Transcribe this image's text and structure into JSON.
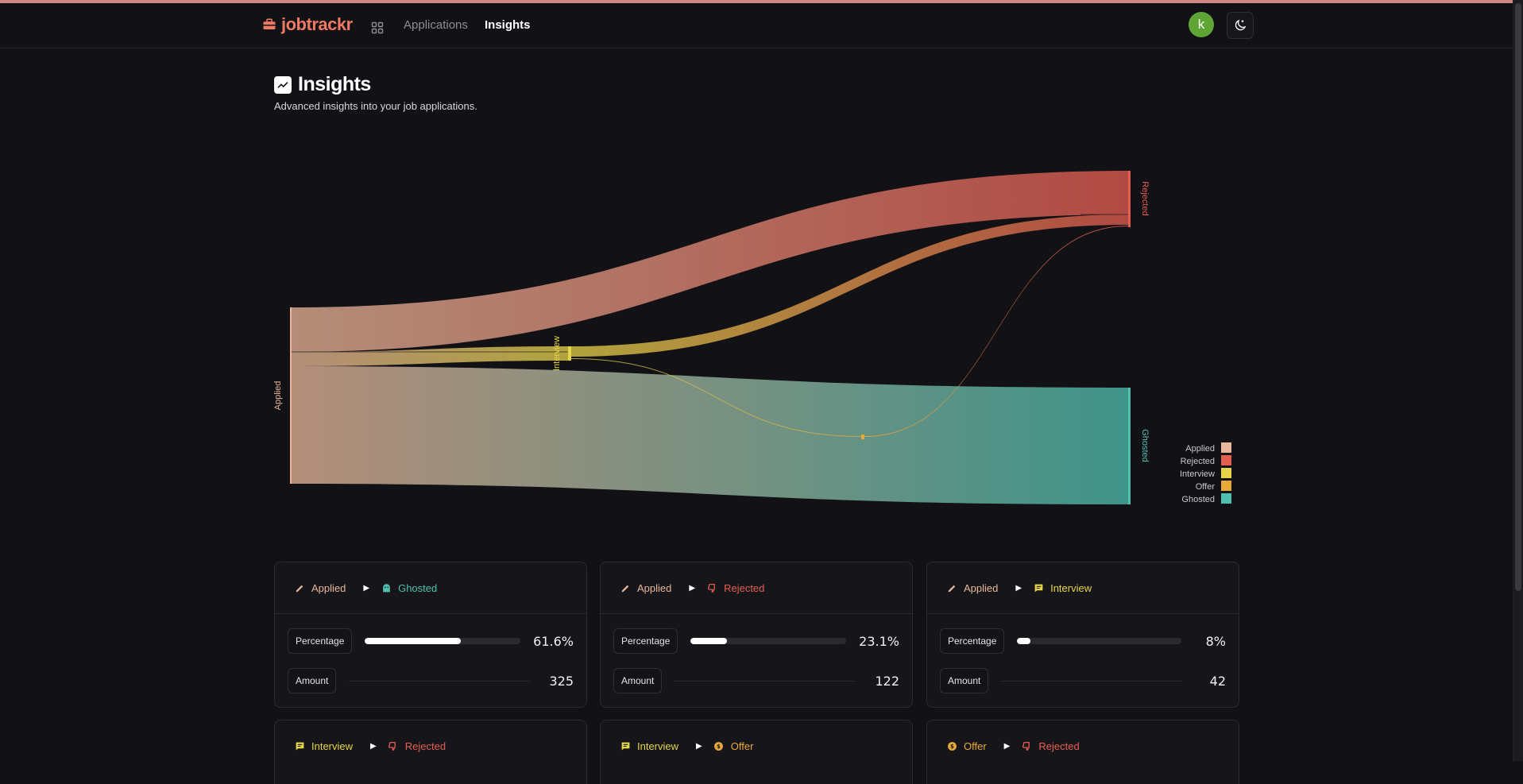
{
  "app": {
    "brand": "jobtrackr",
    "nav": {
      "applications": "Applications",
      "insights": "Insights"
    },
    "avatar_initial": "k"
  },
  "page": {
    "title": "Insights",
    "subtitle": "Advanced insights into your job applications."
  },
  "colors": {
    "applied": "#e9b79a",
    "rejected": "#e65d52",
    "interview": "#e6d449",
    "offer": "#e8a93b",
    "ghosted": "#4fc0b0",
    "brand": "#ee7a64",
    "avatar": "#5fa535"
  },
  "sankey": {
    "nodes": {
      "applied": "Applied",
      "interview": "Interview",
      "offer": "Offer",
      "rejected": "Rejected",
      "ghosted": "Ghosted"
    },
    "legend": [
      "Applied",
      "Rejected",
      "Interview",
      "Offer",
      "Ghosted"
    ]
  },
  "labels": {
    "percentage": "Percentage",
    "amount": "Amount"
  },
  "cards": [
    {
      "from": "Applied",
      "to": "Ghosted",
      "percentage": "61.6%",
      "fraction": 0.616,
      "amount": "325"
    },
    {
      "from": "Applied",
      "to": "Rejected",
      "percentage": "23.1%",
      "fraction": 0.231,
      "amount": "122"
    },
    {
      "from": "Applied",
      "to": "Interview",
      "percentage": "8%",
      "fraction": 0.08,
      "amount": "42"
    },
    {
      "from": "Interview",
      "to": "Rejected"
    },
    {
      "from": "Interview",
      "to": "Offer"
    },
    {
      "from": "Offer",
      "to": "Rejected"
    }
  ]
}
